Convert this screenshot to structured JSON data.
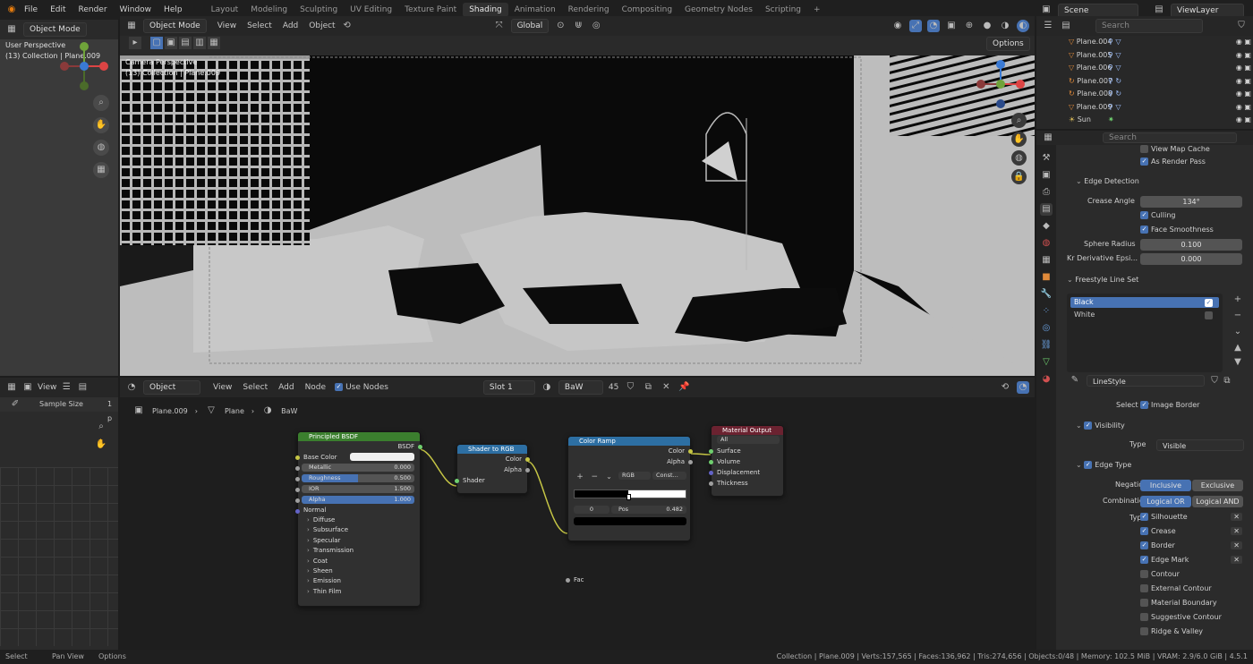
{
  "menu": [
    "File",
    "Edit",
    "Render",
    "Window",
    "Help"
  ],
  "workspaces": [
    "Layout",
    "Modeling",
    "Sculpting",
    "UV Editing",
    "Texture Paint",
    "Shading",
    "Animation",
    "Rendering",
    "Compositing",
    "Geometry Nodes",
    "Scripting"
  ],
  "active_workspace": "Shading",
  "scene": "Scene",
  "view_layer": "ViewLayer",
  "left_vp": {
    "mode": "Object Mode",
    "title": "User Perspective",
    "sub": "(13) Collection | Plane.009"
  },
  "main_vp": {
    "mode": "Object Mode",
    "menus": [
      "View",
      "Select",
      "Add",
      "Object"
    ],
    "transform": "Global",
    "title": "Camera Perspective",
    "sub": "(13) Collection | Plane.009",
    "options": "Options"
  },
  "outliner": {
    "search": "Search",
    "items": [
      "Plane.004",
      "Plane.005",
      "Plane.006",
      "Plane.007",
      "Plane.008",
      "Plane.009",
      "Sun"
    ]
  },
  "props": {
    "search": "Search",
    "view_map_cache": "View Map Cache",
    "as_render_pass": "As Render Pass",
    "edge_detection": "Edge Detection",
    "crease_angle_label": "Crease Angle",
    "crease_angle": "134°",
    "culling": "Culling",
    "face_smoothness": "Face Smoothness",
    "sphere_radius_label": "Sphere Radius",
    "sphere_radius": "0.100",
    "kr_label": "Kr Derivative Epsi...",
    "kr": "0.000",
    "line_set": "Freestyle Line Set",
    "sets": [
      "Black",
      "White"
    ],
    "linestyle": "LineStyle",
    "select_by": "Select by",
    "image_border": "Image Border",
    "visibility": "Visibility",
    "type_label": "Type",
    "type_val": "Visible",
    "edge_type": "Edge Type",
    "negation": "Negation",
    "inclusive": "Inclusive",
    "exclusive": "Exclusive",
    "combination": "Combination",
    "logical_or": "Logical OR",
    "logical_and": "Logical AND",
    "types": [
      {
        "l": "Silhouette",
        "on": true
      },
      {
        "l": "Crease",
        "on": true
      },
      {
        "l": "Border",
        "on": true
      },
      {
        "l": "Edge Mark",
        "on": true
      },
      {
        "l": "Contour",
        "on": false
      },
      {
        "l": "External Contour",
        "on": false
      },
      {
        "l": "Material Boundary",
        "on": false
      },
      {
        "l": "Suggestive Contour",
        "on": false
      },
      {
        "l": "Ridge & Valley",
        "on": false
      }
    ]
  },
  "img_editor": {
    "view": "View",
    "sample": "Sample Size",
    "sample_val": "1 p"
  },
  "node_editor": {
    "object": "Object",
    "menus": [
      "View",
      "Select",
      "Add",
      "Node"
    ],
    "use_nodes": "Use Nodes",
    "slot": "Slot 1",
    "material": "BaW",
    "users": "45",
    "bc": [
      "Plane.009",
      "Plane",
      "BaW"
    ]
  },
  "nodes": {
    "bsdf": {
      "title": "Principled BSDF",
      "out": "BSDF",
      "base": "Base Color",
      "metallic": "Metallic",
      "metallic_v": "0.000",
      "rough": "Roughness",
      "rough_v": "0.500",
      "ior": "IOR",
      "ior_v": "1.500",
      "alpha": "Alpha",
      "alpha_v": "1.000",
      "normal": "Normal",
      "subs": [
        "Diffuse",
        "Subsurface",
        "Specular",
        "Transmission",
        "Coat",
        "Sheen",
        "Emission",
        "Thin Film"
      ]
    },
    "s2rgb": {
      "title": "Shader to RGB",
      "color": "Color",
      "alpha": "Alpha",
      "shader": "Shader"
    },
    "ramp": {
      "title": "Color Ramp",
      "color": "Color",
      "alpha": "Alpha",
      "mode": "RGB",
      "interp": "Const...",
      "idx": "0",
      "pos_label": "Pos",
      "pos": "0.482",
      "fac": "Fac"
    },
    "out": {
      "title": "Material Output",
      "target": "All",
      "surface": "Surface",
      "volume": "Volume",
      "disp": "Displacement",
      "thick": "Thickness"
    }
  },
  "status": {
    "select": "Select",
    "pan": "Pan View",
    "options": "Options",
    "info": "Collection | Plane.009 | Verts:157,565 | Faces:136,962 | Tris:274,656 | Objects:0/48 | Memory: 102.5 MiB | VRAM: 2.9/6.0 GiB | 4.5.1"
  }
}
